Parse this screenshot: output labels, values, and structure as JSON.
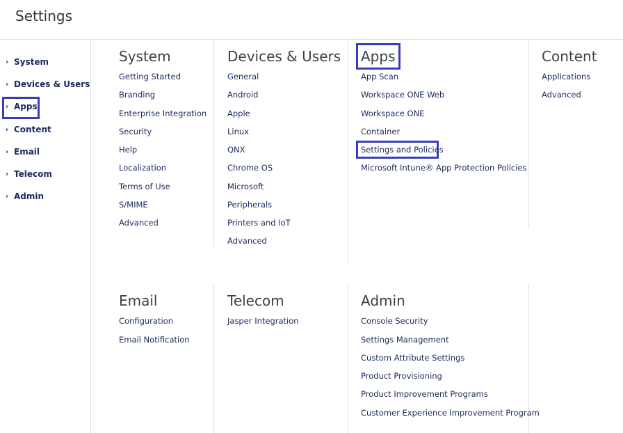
{
  "header": {
    "title": "Settings"
  },
  "sidebar": {
    "items": [
      {
        "label": "System"
      },
      {
        "label": "Devices & Users"
      },
      {
        "label": "Apps"
      },
      {
        "label": "Content"
      },
      {
        "label": "Email"
      },
      {
        "label": "Telecom"
      },
      {
        "label": "Admin"
      }
    ]
  },
  "sections": {
    "system": {
      "title": "System",
      "links": [
        "Getting Started",
        "Branding",
        "Enterprise Integration",
        "Security",
        "Help",
        "Localization",
        "Terms of Use",
        "S/MIME",
        "Advanced"
      ]
    },
    "devices": {
      "title": "Devices & Users",
      "links": [
        "General",
        "Android",
        "Apple",
        "Linux",
        "QNX",
        "Chrome OS",
        "Microsoft",
        "Peripherals",
        "Printers and IoT",
        "Advanced"
      ]
    },
    "apps": {
      "title": "Apps",
      "links": [
        "App Scan",
        "Workspace ONE Web",
        "Workspace ONE",
        "Container",
        "Settings and Policies",
        "Microsoft Intune® App Protection Policies"
      ]
    },
    "content": {
      "title": "Content",
      "links": [
        "Applications",
        "Advanced"
      ]
    },
    "email": {
      "title": "Email",
      "links": [
        "Configuration",
        "Email Notification"
      ]
    },
    "telecom": {
      "title": "Telecom",
      "links": [
        "Jasper Integration"
      ]
    },
    "admin": {
      "title": "Admin",
      "links": [
        "Console Security",
        "Settings Management",
        "Custom Attribute Settings",
        "Product Provisioning",
        "Product Improvement Programs",
        "Customer Experience Improvement Program"
      ]
    }
  },
  "colors": {
    "text": "#1b2a5c",
    "highlight": "#3a3db8",
    "divider": "#dcdde3"
  }
}
